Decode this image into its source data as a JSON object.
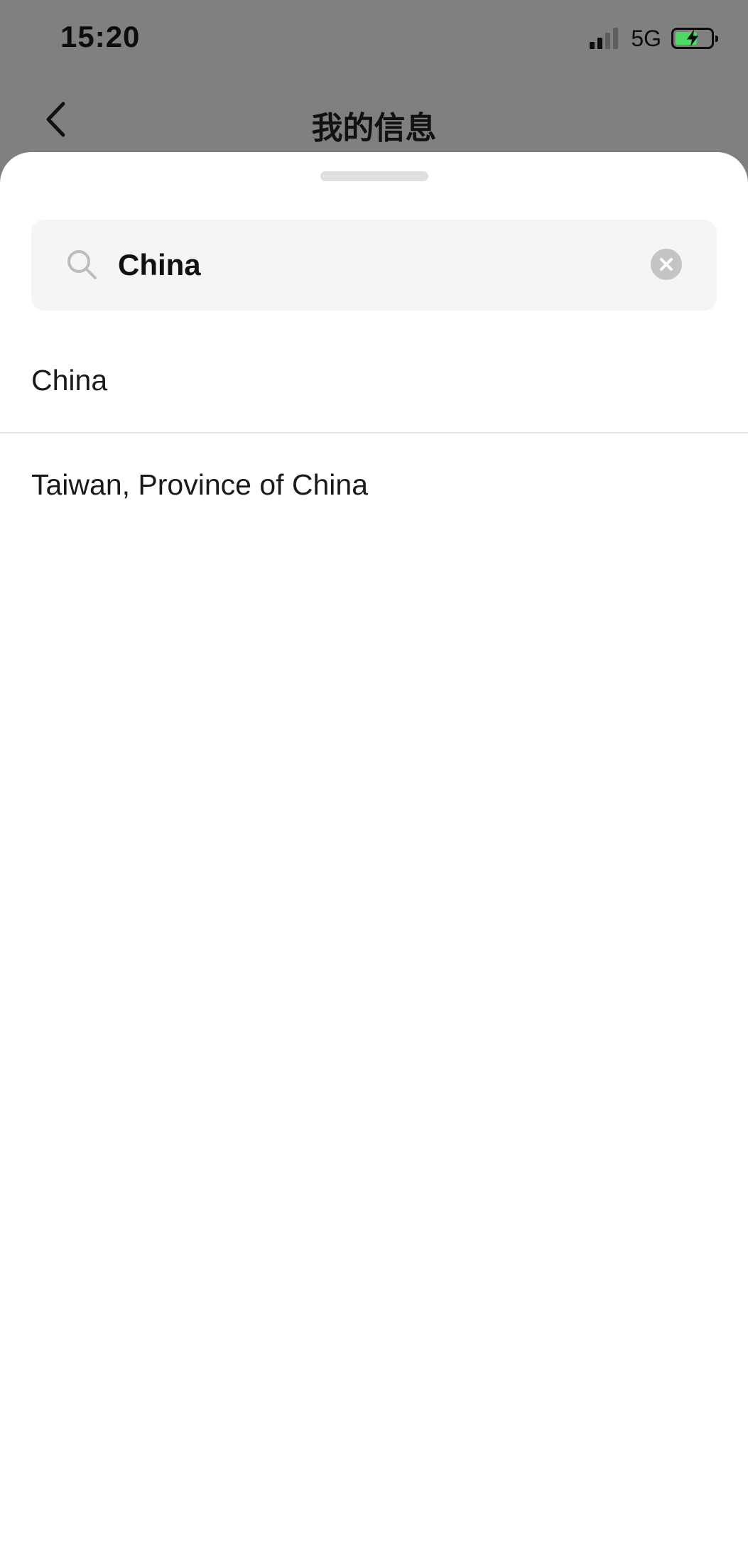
{
  "status_bar": {
    "time": "15:20",
    "network": "5G",
    "battery_level": 0.62,
    "battery_charging": true,
    "signal_bars": 4,
    "signal_bars_active": 2
  },
  "nav": {
    "title": "我的信息"
  },
  "search": {
    "value": "China",
    "placeholder": ""
  },
  "results": [
    {
      "label": "China"
    },
    {
      "label": "Taiwan, Province of China"
    }
  ],
  "colors": {
    "overlay": "#808080",
    "sheet": "#ffffff",
    "search_bg": "#f4f5f5",
    "battery_green": "#4cd964",
    "divider": "#e6e6e6"
  }
}
